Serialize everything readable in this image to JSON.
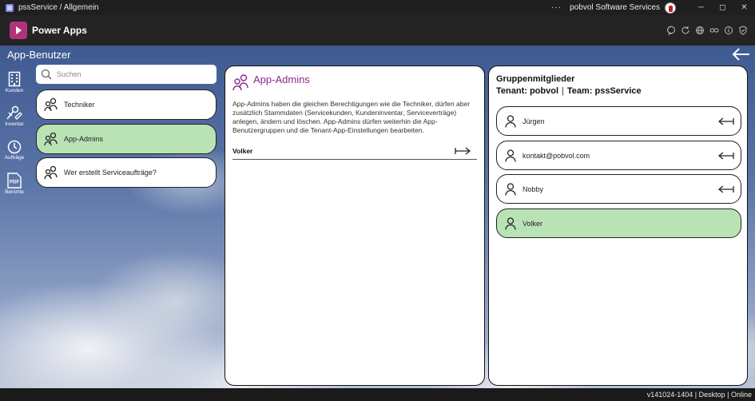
{
  "window": {
    "title": "pssService / Allgemein",
    "account": "pobvol Software Services",
    "more_label": "···",
    "minimize_label": "─",
    "maximize_label": "◻",
    "close_label": "✕"
  },
  "header": {
    "product": "Power Apps",
    "tools": [
      "chat-icon",
      "refresh-icon",
      "globe-icon",
      "link-icon",
      "info-icon",
      "shield-icon"
    ]
  },
  "app": {
    "title": "App-Benutzer"
  },
  "nav": {
    "items": [
      {
        "label": "Kunden",
        "icon": "building-icon"
      },
      {
        "label": "Inventar",
        "icon": "tools-icon"
      },
      {
        "label": "Aufträge",
        "icon": "clock-icon"
      },
      {
        "label": "Berichte",
        "icon": "pdf-icon"
      }
    ]
  },
  "search": {
    "placeholder": "Suchen",
    "value": ""
  },
  "groups": [
    {
      "label": "Techniker",
      "selected": false
    },
    {
      "label": "App-Admins",
      "selected": true
    },
    {
      "label": "Wer erstellt Serviceaufträge?",
      "selected": false
    }
  ],
  "detail": {
    "title": "App-Admins",
    "description": "App-Admins haben die gleichen Berechtigungen wie die Techniker, dürfen aber zusätzlich Stammdaten (Servicekunden, Kundeninventar, Serviceverträge) anlegen, ändern und löschen. App-Admins dürfen weiterhin die App-Benutzergruppen und die Tenant-App-Einstellungen bearbeiten.",
    "members": [
      "Volker"
    ]
  },
  "members_panel": {
    "title": "Gruppenmitglieder",
    "tenant_label": "Tenant: pobvol",
    "separator": "|",
    "team_label": "Team: pssService",
    "members": [
      {
        "name": "Jürgen",
        "selected": false
      },
      {
        "name": "kontakt@pobvol.com",
        "selected": false
      },
      {
        "name": "Nobby",
        "selected": false
      },
      {
        "name": "Volker",
        "selected": true
      }
    ]
  },
  "footer": {
    "status": "v141024-1404 | Desktop | Online"
  },
  "colors": {
    "accent_purple": "#8a2a8e",
    "selected_green": "#b9e3b4",
    "brand_powerapps": "#b3337a"
  }
}
